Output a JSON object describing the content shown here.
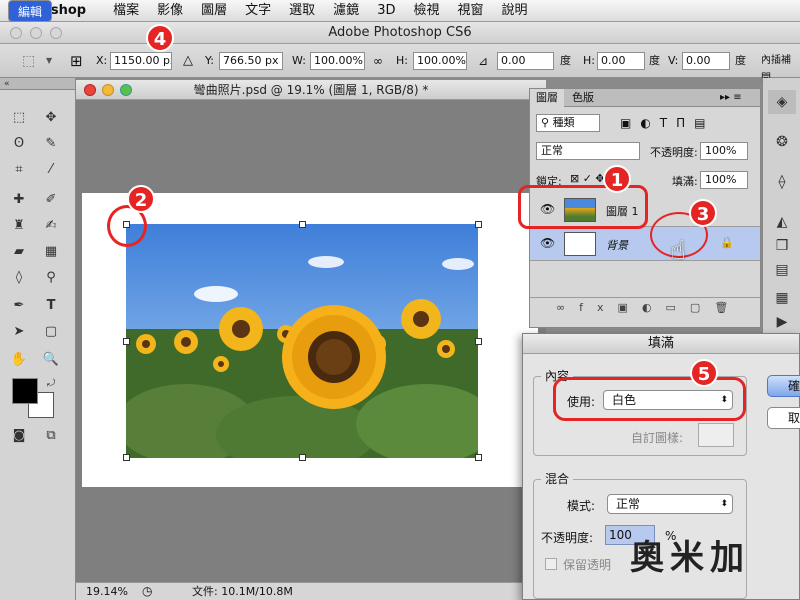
{
  "menubar": {
    "app": "Photoshop",
    "items": [
      "檔案",
      "編輯",
      "影像",
      "圖層",
      "文字",
      "選取",
      "濾鏡",
      "3D",
      "檢視",
      "視窗",
      "說明"
    ],
    "selected_index": 1
  },
  "window": {
    "title": "Adobe Photoshop CS6"
  },
  "options": {
    "x_label": "X:",
    "x_value": "1150.00 px",
    "y_label": "Y:",
    "y_value": "766.50 px",
    "w_label": "W:",
    "w_value": "100.00%",
    "h_label": "H:",
    "h_value": "100.00%",
    "angle_value": "0.00",
    "deg1": "度",
    "hskew_label": "H:",
    "hskew_value": "0.00",
    "deg2": "度",
    "vskew_label": "V:",
    "vskew_value": "0.00",
    "deg3": "度",
    "interp": "內插補間"
  },
  "document": {
    "title": "彎曲照片.psd @ 19.1% (圖層 1, RGB/8) *",
    "zoom": "19.14%",
    "file_info": "文件: 10.1M/10.8M"
  },
  "layers_panel": {
    "tab_layers": "圖層",
    "tab_color": "色版",
    "filter_label": "種類",
    "blend_mode": "正常",
    "opacity_label": "不透明度:",
    "opacity_value": "100%",
    "lock_label": "鎖定:",
    "fill_label": "填滿:",
    "fill_value": "100%",
    "layers": [
      {
        "name": "圖層 1"
      },
      {
        "name": "背景"
      }
    ]
  },
  "fill_dialog": {
    "title": "填滿",
    "contents_group": "內容",
    "use_label": "使用:",
    "use_value": "白色",
    "custom_pattern_label": "自訂圖樣:",
    "blend_group": "混合",
    "mode_label": "模式:",
    "mode_value": "正常",
    "opacity_label": "不透明度:",
    "opacity_value": "100",
    "opacity_unit": "%",
    "preserve_label": "保留透明",
    "ok_label": "確",
    "cancel_label": "取"
  },
  "callouts": [
    "1",
    "2",
    "3",
    "4",
    "5"
  ],
  "watermark": "奧米加",
  "colors": {
    "accent": "#2f62d8",
    "callout": "#e52424",
    "layer_selected": "#b7c9ee"
  }
}
